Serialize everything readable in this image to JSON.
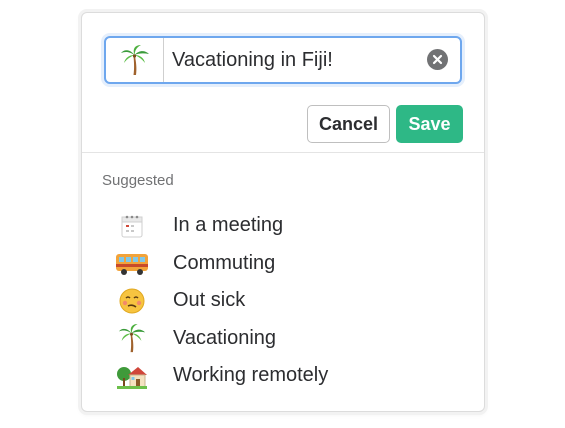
{
  "status_input": {
    "emoji_icon": "palm-tree-icon",
    "value": "Vacationing in Fiji!",
    "clear_icon": "clear-icon"
  },
  "buttons": {
    "cancel_label": "Cancel",
    "save_label": "Save"
  },
  "suggested": {
    "title": "Suggested",
    "items": [
      {
        "icon": "calendar-icon",
        "label": "In a meeting"
      },
      {
        "icon": "bus-icon",
        "label": "Commuting"
      },
      {
        "icon": "sick-face-icon",
        "label": "Out sick"
      },
      {
        "icon": "palm-tree-icon",
        "label": "Vacationing"
      },
      {
        "icon": "house-with-garden-icon",
        "label": "Working remotely"
      }
    ]
  },
  "colors": {
    "accent_focus": "#6ea7ee",
    "save_green": "#2eb886",
    "text": "#2c2d30",
    "muted": "#717274"
  }
}
